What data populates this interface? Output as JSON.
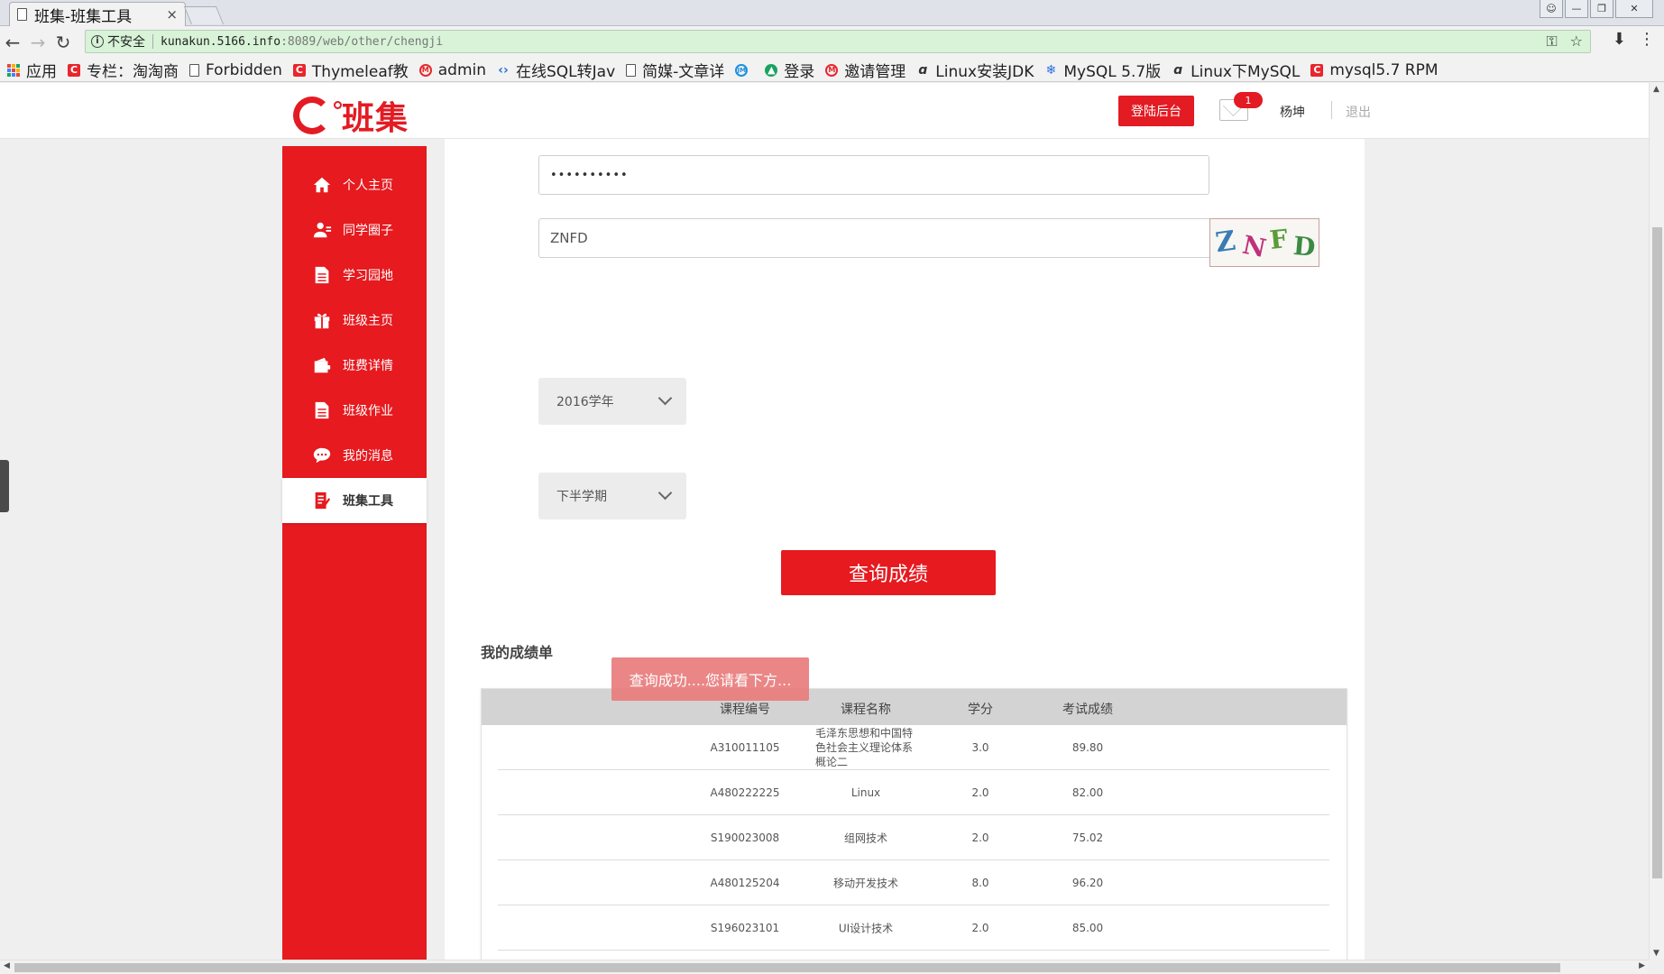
{
  "browser": {
    "tab_title": "班集-班集工具",
    "tab_close": "×",
    "insecure_label": "不安全",
    "url_host": "kunakun.5166.info",
    "url_path": ":8089/web/other/chengji",
    "bookmarks": [
      {
        "label": "应用",
        "icon": "apps-icon"
      },
      {
        "label": "专栏：淘淘商",
        "icon": "csdn-icon"
      },
      {
        "label": "Forbidden",
        "icon": "document-icon"
      },
      {
        "label": "Thymeleaf教",
        "icon": "csdn-icon"
      },
      {
        "label": "admin",
        "icon": "red-circle-icon"
      },
      {
        "label": "在线SQL转Jav",
        "icon": "code-icon"
      },
      {
        "label": "简媒-文章详",
        "icon": "document-icon"
      },
      {
        "label": "",
        "icon": "jm-icon"
      },
      {
        "label": "登录",
        "icon": "green-icon"
      },
      {
        "label": "邀请管理",
        "icon": "red-circle-icon"
      },
      {
        "label": "Linux安装JDK",
        "icon": "script-icon"
      },
      {
        "label": "MySQL 5.7版",
        "icon": "paw-icon"
      },
      {
        "label": "Linux下MySQL",
        "icon": "script-icon"
      },
      {
        "label": "mysql5.7 RPM",
        "icon": "csdn-icon"
      }
    ]
  },
  "header": {
    "logo_text": "班集",
    "admin_button": "登陆后台",
    "mail_count": "1",
    "username": "杨坤",
    "logout": "退出"
  },
  "sidebar": {
    "items": [
      {
        "label": "个人主页",
        "icon": "home-icon",
        "active": false
      },
      {
        "label": "同学圈子",
        "icon": "user-icon",
        "active": false
      },
      {
        "label": "学习园地",
        "icon": "document-icon",
        "active": false
      },
      {
        "label": "班级主页",
        "icon": "gift-icon",
        "active": false
      },
      {
        "label": "班费详情",
        "icon": "wallet-icon",
        "active": false
      },
      {
        "label": "班级作业",
        "icon": "document-icon",
        "active": false
      },
      {
        "label": "我的消息",
        "icon": "chat-icon",
        "active": false
      },
      {
        "label": "班集工具",
        "icon": "notes-icon",
        "active": true
      }
    ]
  },
  "form": {
    "password_value": "••••••••••",
    "captcha_value": "ZNFD",
    "captcha_chars": [
      "Z",
      "N",
      "F",
      "D"
    ],
    "year_select": "2016学年",
    "term_select": "下半学期",
    "query_button": "查询成绩"
  },
  "results": {
    "title": "我的成绩单",
    "columns": [
      "课程编号",
      "课程名称",
      "学分",
      "考试成绩"
    ],
    "rows": [
      {
        "code": "A310011105",
        "name": "毛泽东思想和中国特色社会主义理论体系概论二",
        "credit": "3.0",
        "score": "89.80"
      },
      {
        "code": "A480222225",
        "name": "Linux",
        "credit": "2.0",
        "score": "82.00"
      },
      {
        "code": "S190023008",
        "name": "组网技术",
        "credit": "2.0",
        "score": "75.02"
      },
      {
        "code": "A480125204",
        "name": "移动开发技术",
        "credit": "8.0",
        "score": "96.20"
      },
      {
        "code": "S196023101",
        "name": "UI设计技术",
        "credit": "2.0",
        "score": "85.00"
      }
    ],
    "toast": "查询成功....您请看下方..."
  }
}
